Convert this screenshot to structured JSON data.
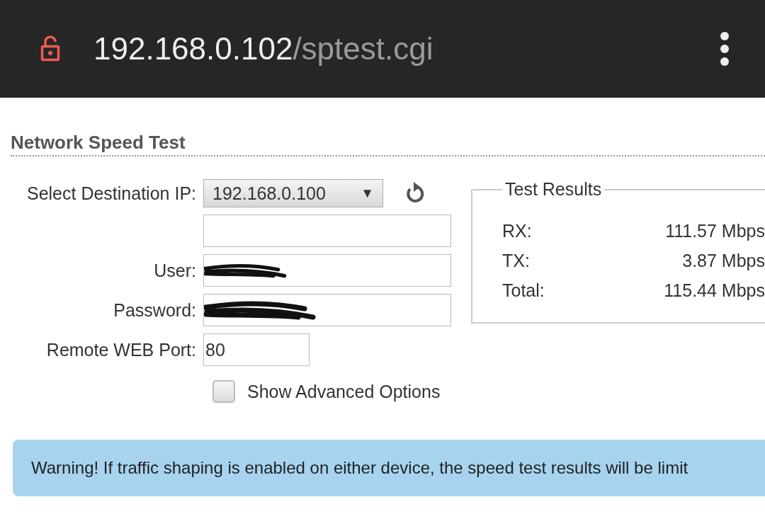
{
  "address_bar": {
    "host": "192.168.0.102",
    "path": "/sptest.cgi",
    "secure": false
  },
  "title": "Network Speed Test",
  "form": {
    "destination": {
      "label": "Select Destination IP:",
      "value": "192.168.0.100",
      "arrow": "▼"
    },
    "fields": [
      {
        "kind": "text",
        "redacted": false
      },
      {
        "kind": "text",
        "label": "User:",
        "redacted": true
      },
      {
        "kind": "text",
        "label": "Password:",
        "redacted": true
      },
      {
        "kind": "port",
        "label": "Remote WEB Port:",
        "value": "80",
        "redacted": false
      }
    ],
    "advanced": {
      "label": "Show Advanced Options",
      "checked": false
    }
  },
  "results": {
    "legend": "Test Results",
    "rows": [
      {
        "label": "RX:",
        "value": "111.57 Mbps"
      },
      {
        "label": "TX:",
        "value": "3.87 Mbps"
      },
      {
        "label": "Total:",
        "value": "115.44 Mbps"
      }
    ]
  },
  "warning": "Warning! If traffic shaping is enabled on either device, the speed test results will be limit"
}
